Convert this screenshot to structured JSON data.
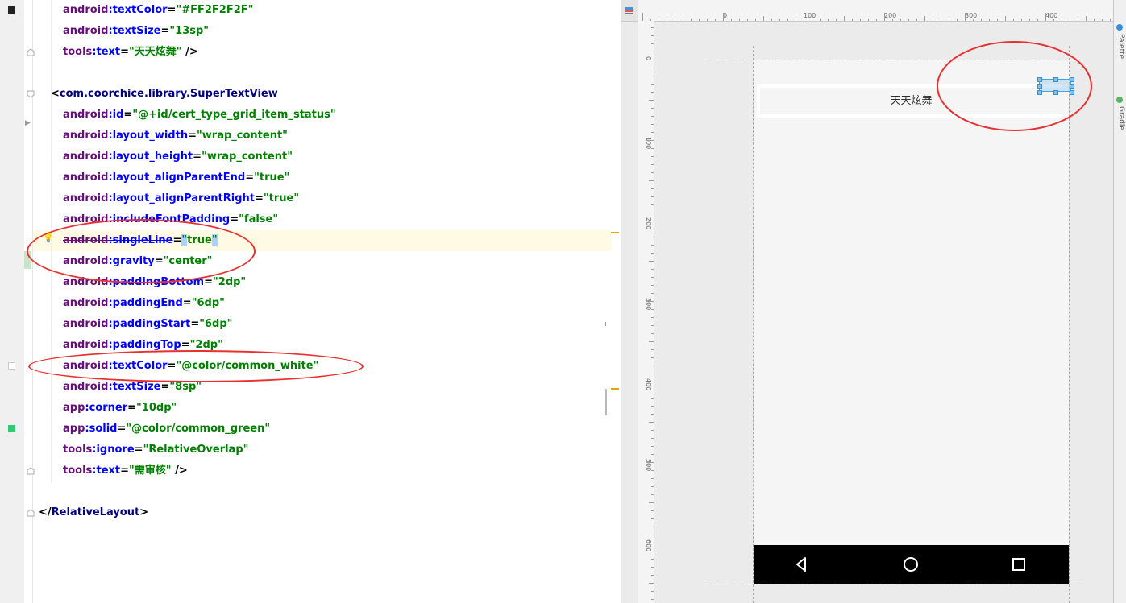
{
  "editor": {
    "lines": [
      {
        "indent": 2,
        "parts": [
          {
            "t": "android",
            "c": "ns"
          },
          {
            "t": ":textColor",
            "c": "attr"
          },
          {
            "t": "=",
            "c": "eq"
          },
          {
            "t": "\"#FF2F2F2F\"",
            "c": "val"
          }
        ]
      },
      {
        "indent": 2,
        "parts": [
          {
            "t": "android",
            "c": "ns"
          },
          {
            "t": ":textSize",
            "c": "attr"
          },
          {
            "t": "=",
            "c": "eq"
          },
          {
            "t": "\"13sp\"",
            "c": "val"
          }
        ]
      },
      {
        "indent": 2,
        "parts": [
          {
            "t": "tools",
            "c": "ns"
          },
          {
            "t": ":text",
            "c": "attr"
          },
          {
            "t": "=",
            "c": "eq"
          },
          {
            "t": "\"天天炫舞\"",
            "c": "val"
          },
          {
            "t": " />",
            "c": "punct"
          }
        ]
      },
      {
        "indent": 0,
        "parts": []
      },
      {
        "indent": 1,
        "parts": [
          {
            "t": "<",
            "c": "punct"
          },
          {
            "t": "com.coorchice.library.SuperTextView",
            "c": "tag"
          }
        ]
      },
      {
        "indent": 2,
        "parts": [
          {
            "t": "android",
            "c": "ns"
          },
          {
            "t": ":id",
            "c": "attr"
          },
          {
            "t": "=",
            "c": "eq"
          },
          {
            "t": "\"@+id/cert_type_grid_item_status\"",
            "c": "val"
          }
        ]
      },
      {
        "indent": 2,
        "parts": [
          {
            "t": "android",
            "c": "ns"
          },
          {
            "t": ":layout_width",
            "c": "attr"
          },
          {
            "t": "=",
            "c": "eq"
          },
          {
            "t": "\"wrap_content\"",
            "c": "val"
          }
        ]
      },
      {
        "indent": 2,
        "parts": [
          {
            "t": "android",
            "c": "ns"
          },
          {
            "t": ":layout_height",
            "c": "attr"
          },
          {
            "t": "=",
            "c": "eq"
          },
          {
            "t": "\"wrap_content\"",
            "c": "val"
          }
        ]
      },
      {
        "indent": 2,
        "parts": [
          {
            "t": "android",
            "c": "ns"
          },
          {
            "t": ":layout_alignParentEnd",
            "c": "attr"
          },
          {
            "t": "=",
            "c": "eq"
          },
          {
            "t": "\"true\"",
            "c": "val"
          }
        ]
      },
      {
        "indent": 2,
        "parts": [
          {
            "t": "android",
            "c": "ns"
          },
          {
            "t": ":layout_alignParentRight",
            "c": "attr"
          },
          {
            "t": "=",
            "c": "eq"
          },
          {
            "t": "\"true\"",
            "c": "val"
          }
        ]
      },
      {
        "indent": 2,
        "parts": [
          {
            "t": "android",
            "c": "ns"
          },
          {
            "t": ":includeFontPadding",
            "c": "attr"
          },
          {
            "t": "=",
            "c": "eq"
          },
          {
            "t": "\"false\"",
            "c": "val"
          }
        ]
      },
      {
        "indent": 2,
        "strike": true,
        "parts": [
          {
            "t": "android",
            "c": "ns"
          },
          {
            "t": ":singleLine",
            "c": "attr"
          },
          {
            "t": "=",
            "c": "eq"
          },
          {
            "t": "\"",
            "c": "val"
          },
          {
            "t": "true",
            "c": "val"
          },
          {
            "t": "\"",
            "c": "val"
          }
        ]
      },
      {
        "indent": 2,
        "parts": [
          {
            "t": "android",
            "c": "ns"
          },
          {
            "t": ":gravity",
            "c": "attr"
          },
          {
            "t": "=",
            "c": "eq"
          },
          {
            "t": "\"center\"",
            "c": "val"
          }
        ]
      },
      {
        "indent": 2,
        "parts": [
          {
            "t": "android",
            "c": "ns"
          },
          {
            "t": ":paddingBottom",
            "c": "attr"
          },
          {
            "t": "=",
            "c": "eq"
          },
          {
            "t": "\"2dp\"",
            "c": "val"
          }
        ]
      },
      {
        "indent": 2,
        "parts": [
          {
            "t": "android",
            "c": "ns"
          },
          {
            "t": ":paddingEnd",
            "c": "attr"
          },
          {
            "t": "=",
            "c": "eq"
          },
          {
            "t": "\"6dp\"",
            "c": "val"
          }
        ]
      },
      {
        "indent": 2,
        "parts": [
          {
            "t": "android",
            "c": "ns"
          },
          {
            "t": ":paddingStart",
            "c": "attr"
          },
          {
            "t": "=",
            "c": "eq"
          },
          {
            "t": "\"6dp\"",
            "c": "val"
          }
        ]
      },
      {
        "indent": 2,
        "parts": [
          {
            "t": "android",
            "c": "ns"
          },
          {
            "t": ":paddingTop",
            "c": "attr"
          },
          {
            "t": "=",
            "c": "eq"
          },
          {
            "t": "\"2dp\"",
            "c": "val"
          }
        ]
      },
      {
        "indent": 2,
        "parts": [
          {
            "t": "android",
            "c": "ns"
          },
          {
            "t": ":textColor",
            "c": "attr"
          },
          {
            "t": "=",
            "c": "eq"
          },
          {
            "t": "\"@color/common_white\"",
            "c": "val"
          }
        ]
      },
      {
        "indent": 2,
        "parts": [
          {
            "t": "android",
            "c": "ns"
          },
          {
            "t": ":textSize",
            "c": "attr"
          },
          {
            "t": "=",
            "c": "eq"
          },
          {
            "t": "\"8sp\"",
            "c": "val"
          }
        ]
      },
      {
        "indent": 2,
        "parts": [
          {
            "t": "app",
            "c": "ns"
          },
          {
            "t": ":corner",
            "c": "attr"
          },
          {
            "t": "=",
            "c": "eq"
          },
          {
            "t": "\"10dp\"",
            "c": "val"
          }
        ]
      },
      {
        "indent": 2,
        "parts": [
          {
            "t": "app",
            "c": "ns"
          },
          {
            "t": ":solid",
            "c": "attr"
          },
          {
            "t": "=",
            "c": "eq"
          },
          {
            "t": "\"@color/common_green\"",
            "c": "val"
          }
        ]
      },
      {
        "indent": 2,
        "parts": [
          {
            "t": "tools",
            "c": "ns"
          },
          {
            "t": ":ignore",
            "c": "attr"
          },
          {
            "t": "=",
            "c": "eq"
          },
          {
            "t": "\"RelativeOverlap\"",
            "c": "val"
          }
        ]
      },
      {
        "indent": 2,
        "parts": [
          {
            "t": "tools",
            "c": "ns"
          },
          {
            "t": ":text",
            "c": "attr"
          },
          {
            "t": "=",
            "c": "eq"
          },
          {
            "t": "\"需审核\"",
            "c": "val"
          },
          {
            "t": " />",
            "c": "punct"
          }
        ]
      },
      {
        "indent": 0,
        "parts": []
      },
      {
        "indent": 0,
        "parts": [
          {
            "t": "</",
            "c": "punct"
          },
          {
            "t": "RelativeLayout",
            "c": "tag"
          },
          {
            "t": ">",
            "c": "punct"
          }
        ]
      }
    ],
    "colors": {
      "namespace": "#660e7a",
      "attribute": "#0000ff",
      "value": "#008000",
      "tag": "#000080",
      "highlight_row": "#fffae3",
      "annotation": "#e83030"
    }
  },
  "preview": {
    "ruler_h_labels": [
      "0",
      "100",
      "200",
      "300",
      "400"
    ],
    "ruler_v_labels": [
      "0",
      "100",
      "200",
      "300",
      "400",
      "500",
      "600"
    ],
    "item_text": "天天炫舞",
    "side_labels": [
      "Palette",
      "Gradle"
    ],
    "nav_icons": [
      "back-icon",
      "home-icon",
      "recents-icon"
    ]
  }
}
